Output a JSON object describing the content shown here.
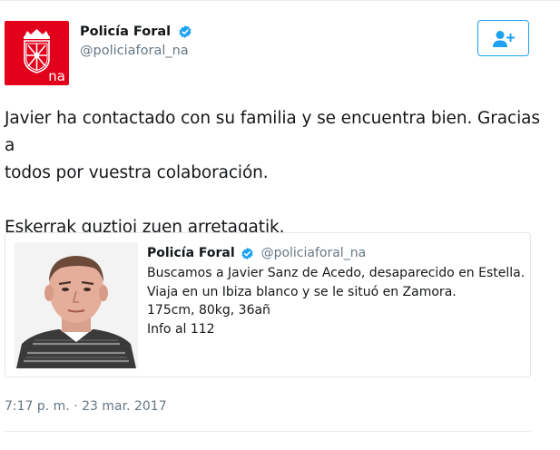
{
  "author": {
    "display_name": "Policía Foral",
    "handle": "@policiaforal_na",
    "avatar_text": "na",
    "avatar_color": "#e2001a",
    "verified": true,
    "verified_icon": "verified-badge-icon"
  },
  "follow_button": {
    "icon": "add-user-icon",
    "accent_color": "#1da1f2"
  },
  "tweet": {
    "line1": "Javier ha contactado con su familia y se encuentra bien. Gracias a",
    "line2": "todos por vuestra colaboración.",
    "line3": "Eskerrak guztioi zuen arretagatik."
  },
  "quoted_tweet": {
    "display_name": "Policía Foral",
    "handle": "@policiaforal_na",
    "verified": true,
    "lines": [
      "Buscamos a Javier Sanz de Acedo, desaparecido en Estella.",
      "Viaja en un Ibiza blanco y se le situó en Zamora.",
      "175cm, 80kg, 36añ",
      "Info al 112"
    ]
  },
  "timestamp": "7:17 p. m. · 23 mar. 2017"
}
